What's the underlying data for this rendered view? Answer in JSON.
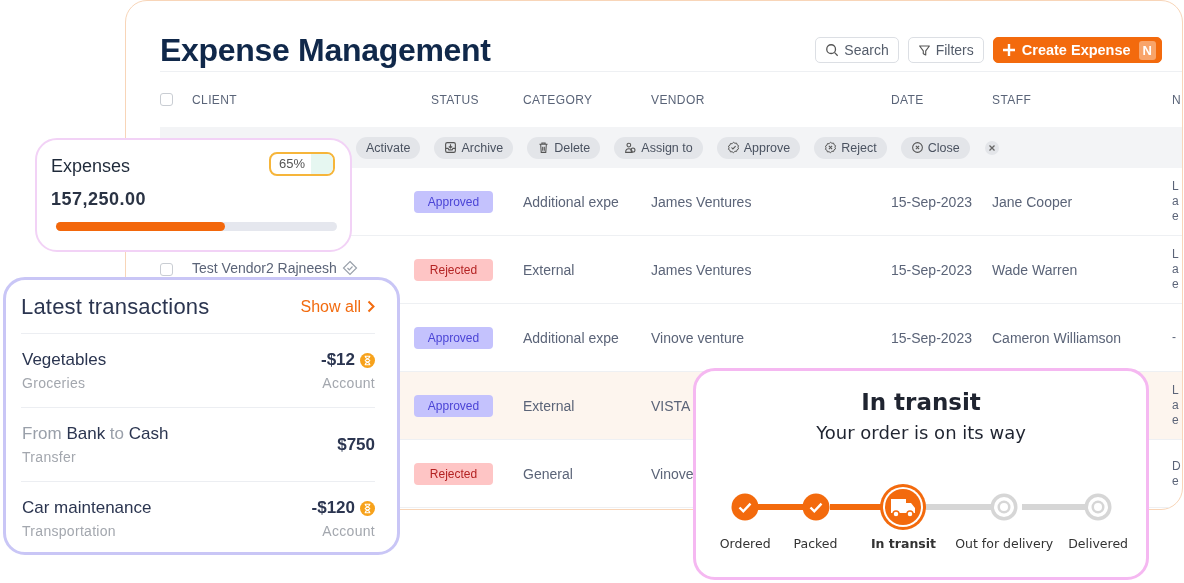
{
  "expense_panel": {
    "title": "Expense Management",
    "search_button": "Search",
    "filters_button": "Filters",
    "create_button": {
      "label": "Create Expense",
      "shortcut": "N"
    },
    "table": {
      "select_all_checked": false,
      "columns": [
        "CLIENT",
        "STATUS",
        "CATEGORY",
        "VENDOR",
        "DATE",
        "STAFF",
        "N"
      ],
      "bulk_actions": [
        {
          "label": "Activate",
          "kind": "plain"
        },
        {
          "label": "Archive",
          "kind": "archive"
        },
        {
          "label": "Delete",
          "kind": "delete"
        },
        {
          "label": "Assign to",
          "kind": "assign"
        },
        {
          "label": "Approve",
          "kind": "approve"
        },
        {
          "label": "Reject",
          "kind": "reject"
        },
        {
          "label": "Close",
          "kind": "close"
        }
      ],
      "rows": [
        {
          "status": "Approved",
          "kind": "approved",
          "category": "Additional expe",
          "vendor": "James Ventures",
          "date": "15-Sep-2023",
          "staff": "Jane Cooper",
          "column_7": "L a e",
          "highlighted": false
        },
        {
          "client": "Test Vendor2 Rajneesh",
          "checked": false,
          "status": "Rejected",
          "kind": "rejected",
          "category": "External",
          "vendor": "James Ventures",
          "date": "15-Sep-2023",
          "staff": "Wade Warren",
          "column_7": "L a e",
          "highlighted": false
        },
        {
          "status": "Approved",
          "kind": "approved",
          "category": "Additional expe",
          "vendor": "Vinove venture",
          "date": "15-Sep-2023",
          "staff": "Cameron Williamson",
          "column_7": "-",
          "highlighted": false
        },
        {
          "status": "Approved",
          "kind": "approved",
          "category": "External",
          "vendor": "VISTA",
          "column_7": "L a e",
          "highlighted": true
        },
        {
          "status": "Rejected",
          "kind": "rejected",
          "category": "General",
          "vendor": "Vinove",
          "column_7": "D e",
          "highlighted": false
        }
      ]
    }
  },
  "expenses_card": {
    "title": "Expenses",
    "percent": "65%",
    "amount": "157,250.00",
    "level": 0.6
  },
  "transactions_card": {
    "title": "Latest transactions",
    "link": "Show all",
    "items": [
      {
        "title": "Vegetables",
        "subtitle": "Groceries",
        "amount": "-$12",
        "account": "Account",
        "pending": true
      },
      {
        "title": "From **Bank** to **Cash**",
        "subtitle": "Transfer",
        "amount": "$750",
        "pending": false
      },
      {
        "title": "Car maintenance",
        "subtitle": "Transportation",
        "amount": "-$120",
        "account": "Account",
        "pending": true
      }
    ]
  },
  "transit_card": {
    "title": "In transit",
    "subtitle": "Your order is on its way",
    "steps": [
      {
        "label": "Ordered",
        "completed": true,
        "current": false
      },
      {
        "label": "Packed",
        "completed": true,
        "current": false
      },
      {
        "label": "In transit",
        "completed": false,
        "current": true
      },
      {
        "label": "Out for delivery",
        "completed": false,
        "current": false
      },
      {
        "label": "Delivered",
        "completed": false,
        "current": false
      }
    ]
  }
}
